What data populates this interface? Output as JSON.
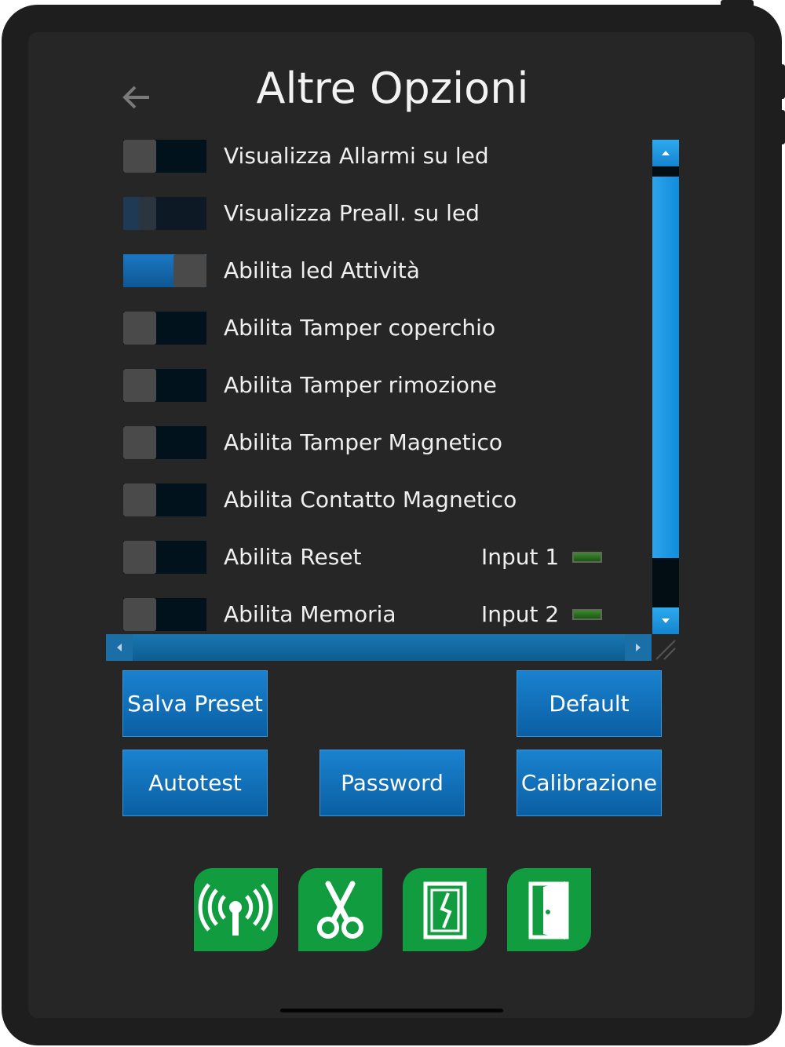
{
  "header": {
    "title": "Altre Opzioni",
    "back_icon": "arrow-left-icon"
  },
  "options": [
    {
      "label": "Visualizza Allarmi su led",
      "state": "off"
    },
    {
      "label": "Visualizza Preall. su led",
      "state": "transitioning"
    },
    {
      "label": "Abilita led Attività",
      "state": "on"
    },
    {
      "label": "Abilita Tamper coperchio",
      "state": "off"
    },
    {
      "label": "Abilita Tamper rimozione",
      "state": "off"
    },
    {
      "label": "Abilita Tamper Magnetico",
      "state": "off"
    },
    {
      "label": "Abilita Contatto Magnetico",
      "state": "off"
    },
    {
      "label": "Abilita Reset",
      "state": "off",
      "input_label": "Input 1",
      "input_led": "green"
    },
    {
      "label": "Abilita Memoria",
      "state": "off",
      "input_label": "Input 2",
      "input_led": "green"
    }
  ],
  "actions": {
    "salva_preset": "Salva Preset",
    "default": "Default",
    "autotest": "Autotest",
    "password": "Password",
    "calibrazione": "Calibrazione"
  },
  "toolbar": {
    "icons": [
      "antenna-icon",
      "scissors-icon",
      "broken-glass-door-icon",
      "open-door-icon"
    ]
  },
  "colors": {
    "background": "#262626",
    "accent_blue": "#0a6fbf",
    "tool_green": "#119d3f",
    "led_green": "#2f7a24"
  }
}
